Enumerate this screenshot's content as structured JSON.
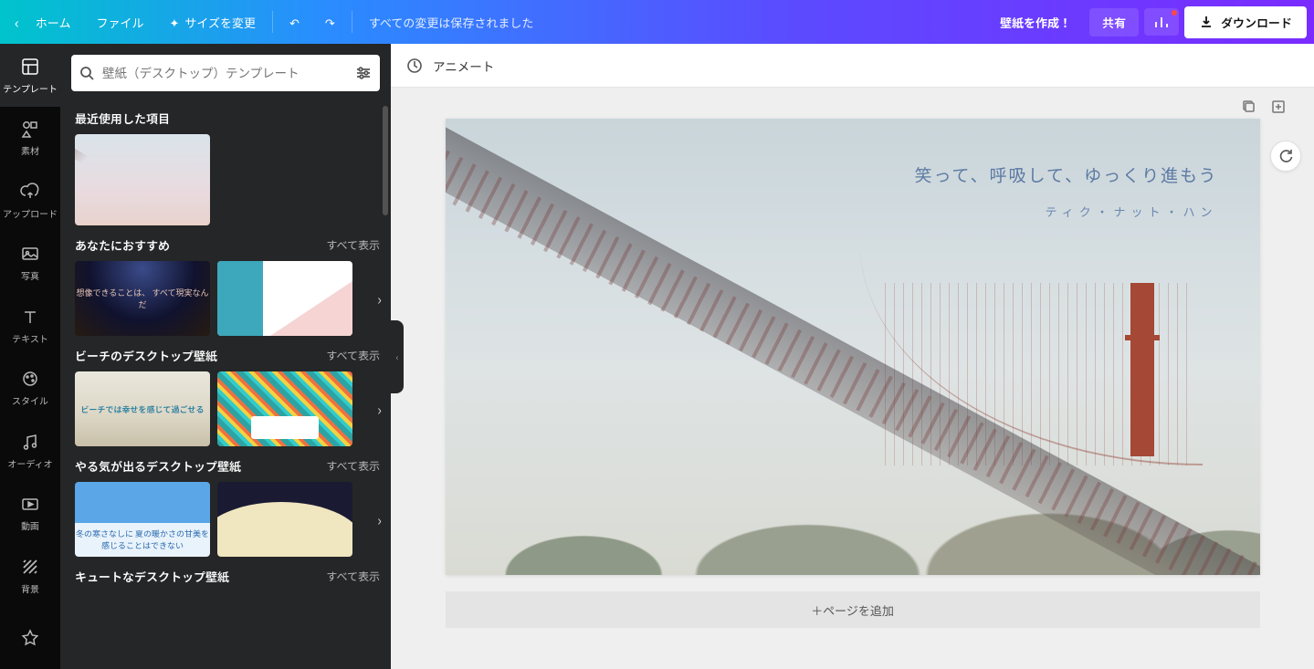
{
  "topbar": {
    "home": "ホーム",
    "file": "ファイル",
    "resize": "サイズを変更",
    "undo_icon": "undo",
    "redo_icon": "redo",
    "save_status": "すべての変更は保存されました",
    "create_wallpaper": "壁紙を作成！",
    "share": "共有",
    "download": "ダウンロード"
  },
  "rail": {
    "items": [
      {
        "label": "テンプレート"
      },
      {
        "label": "素材"
      },
      {
        "label": "アップロード"
      },
      {
        "label": "写真"
      },
      {
        "label": "テキスト"
      },
      {
        "label": "スタイル"
      },
      {
        "label": "オーディオ"
      },
      {
        "label": "動画"
      },
      {
        "label": "背景"
      }
    ]
  },
  "search": {
    "placeholder": "壁紙（デスクトップ）テンプレート",
    "icon": "search",
    "filter": "sliders"
  },
  "sections": {
    "recent": {
      "title": "最近使用した項目"
    },
    "recommended": {
      "title": "あなたにおすすめ",
      "see_all": "すべて表示",
      "thumbs": [
        {
          "text": "想像できることは、\nすべて現実なんだ"
        },
        {
          "text": ""
        }
      ]
    },
    "beach": {
      "title": "ビーチのデスクトップ壁紙",
      "see_all": "すべて表示",
      "thumbs": [
        {
          "text": "ビーチでは幸せを感じて過ごせる"
        },
        {
          "text": ""
        }
      ]
    },
    "motivate": {
      "title": "やる気が出るデスクトップ壁紙",
      "see_all": "すべて表示",
      "thumbs": [
        {
          "text": "冬の寒さなしに\n夏の暖かさの甘美を\n感じることはできない"
        },
        {
          "text": ""
        }
      ]
    },
    "cute": {
      "title": "キュートなデスクトップ壁紙",
      "see_all": "すべて表示"
    }
  },
  "context": {
    "animate": "アニメート"
  },
  "canvas": {
    "quote": "笑って、呼吸して、ゆっくり進もう",
    "author": "ティク・ナット・ハン",
    "add_page": "＋ページを追加"
  }
}
